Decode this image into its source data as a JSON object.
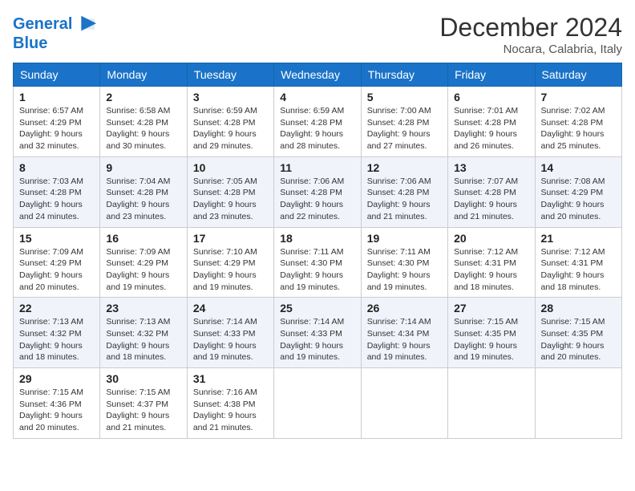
{
  "logo": {
    "line1": "General",
    "line2": "Blue"
  },
  "title": "December 2024",
  "location": "Nocara, Calabria, Italy",
  "weekdays": [
    "Sunday",
    "Monday",
    "Tuesday",
    "Wednesday",
    "Thursday",
    "Friday",
    "Saturday"
  ],
  "weeks": [
    [
      {
        "day": "1",
        "sunrise": "6:57 AM",
        "sunset": "4:29 PM",
        "daylight": "9 hours and 32 minutes."
      },
      {
        "day": "2",
        "sunrise": "6:58 AM",
        "sunset": "4:28 PM",
        "daylight": "9 hours and 30 minutes."
      },
      {
        "day": "3",
        "sunrise": "6:59 AM",
        "sunset": "4:28 PM",
        "daylight": "9 hours and 29 minutes."
      },
      {
        "day": "4",
        "sunrise": "6:59 AM",
        "sunset": "4:28 PM",
        "daylight": "9 hours and 28 minutes."
      },
      {
        "day": "5",
        "sunrise": "7:00 AM",
        "sunset": "4:28 PM",
        "daylight": "9 hours and 27 minutes."
      },
      {
        "day": "6",
        "sunrise": "7:01 AM",
        "sunset": "4:28 PM",
        "daylight": "9 hours and 26 minutes."
      },
      {
        "day": "7",
        "sunrise": "7:02 AM",
        "sunset": "4:28 PM",
        "daylight": "9 hours and 25 minutes."
      }
    ],
    [
      {
        "day": "8",
        "sunrise": "7:03 AM",
        "sunset": "4:28 PM",
        "daylight": "9 hours and 24 minutes."
      },
      {
        "day": "9",
        "sunrise": "7:04 AM",
        "sunset": "4:28 PM",
        "daylight": "9 hours and 23 minutes."
      },
      {
        "day": "10",
        "sunrise": "7:05 AM",
        "sunset": "4:28 PM",
        "daylight": "9 hours and 23 minutes."
      },
      {
        "day": "11",
        "sunrise": "7:06 AM",
        "sunset": "4:28 PM",
        "daylight": "9 hours and 22 minutes."
      },
      {
        "day": "12",
        "sunrise": "7:06 AM",
        "sunset": "4:28 PM",
        "daylight": "9 hours and 21 minutes."
      },
      {
        "day": "13",
        "sunrise": "7:07 AM",
        "sunset": "4:28 PM",
        "daylight": "9 hours and 21 minutes."
      },
      {
        "day": "14",
        "sunrise": "7:08 AM",
        "sunset": "4:29 PM",
        "daylight": "9 hours and 20 minutes."
      }
    ],
    [
      {
        "day": "15",
        "sunrise": "7:09 AM",
        "sunset": "4:29 PM",
        "daylight": "9 hours and 20 minutes."
      },
      {
        "day": "16",
        "sunrise": "7:09 AM",
        "sunset": "4:29 PM",
        "daylight": "9 hours and 19 minutes."
      },
      {
        "day": "17",
        "sunrise": "7:10 AM",
        "sunset": "4:29 PM",
        "daylight": "9 hours and 19 minutes."
      },
      {
        "day": "18",
        "sunrise": "7:11 AM",
        "sunset": "4:30 PM",
        "daylight": "9 hours and 19 minutes."
      },
      {
        "day": "19",
        "sunrise": "7:11 AM",
        "sunset": "4:30 PM",
        "daylight": "9 hours and 19 minutes."
      },
      {
        "day": "20",
        "sunrise": "7:12 AM",
        "sunset": "4:31 PM",
        "daylight": "9 hours and 18 minutes."
      },
      {
        "day": "21",
        "sunrise": "7:12 AM",
        "sunset": "4:31 PM",
        "daylight": "9 hours and 18 minutes."
      }
    ],
    [
      {
        "day": "22",
        "sunrise": "7:13 AM",
        "sunset": "4:32 PM",
        "daylight": "9 hours and 18 minutes."
      },
      {
        "day": "23",
        "sunrise": "7:13 AM",
        "sunset": "4:32 PM",
        "daylight": "9 hours and 18 minutes."
      },
      {
        "day": "24",
        "sunrise": "7:14 AM",
        "sunset": "4:33 PM",
        "daylight": "9 hours and 19 minutes."
      },
      {
        "day": "25",
        "sunrise": "7:14 AM",
        "sunset": "4:33 PM",
        "daylight": "9 hours and 19 minutes."
      },
      {
        "day": "26",
        "sunrise": "7:14 AM",
        "sunset": "4:34 PM",
        "daylight": "9 hours and 19 minutes."
      },
      {
        "day": "27",
        "sunrise": "7:15 AM",
        "sunset": "4:35 PM",
        "daylight": "9 hours and 19 minutes."
      },
      {
        "day": "28",
        "sunrise": "7:15 AM",
        "sunset": "4:35 PM",
        "daylight": "9 hours and 20 minutes."
      }
    ],
    [
      {
        "day": "29",
        "sunrise": "7:15 AM",
        "sunset": "4:36 PM",
        "daylight": "9 hours and 20 minutes."
      },
      {
        "day": "30",
        "sunrise": "7:15 AM",
        "sunset": "4:37 PM",
        "daylight": "9 hours and 21 minutes."
      },
      {
        "day": "31",
        "sunrise": "7:16 AM",
        "sunset": "4:38 PM",
        "daylight": "9 hours and 21 minutes."
      },
      null,
      null,
      null,
      null
    ]
  ]
}
